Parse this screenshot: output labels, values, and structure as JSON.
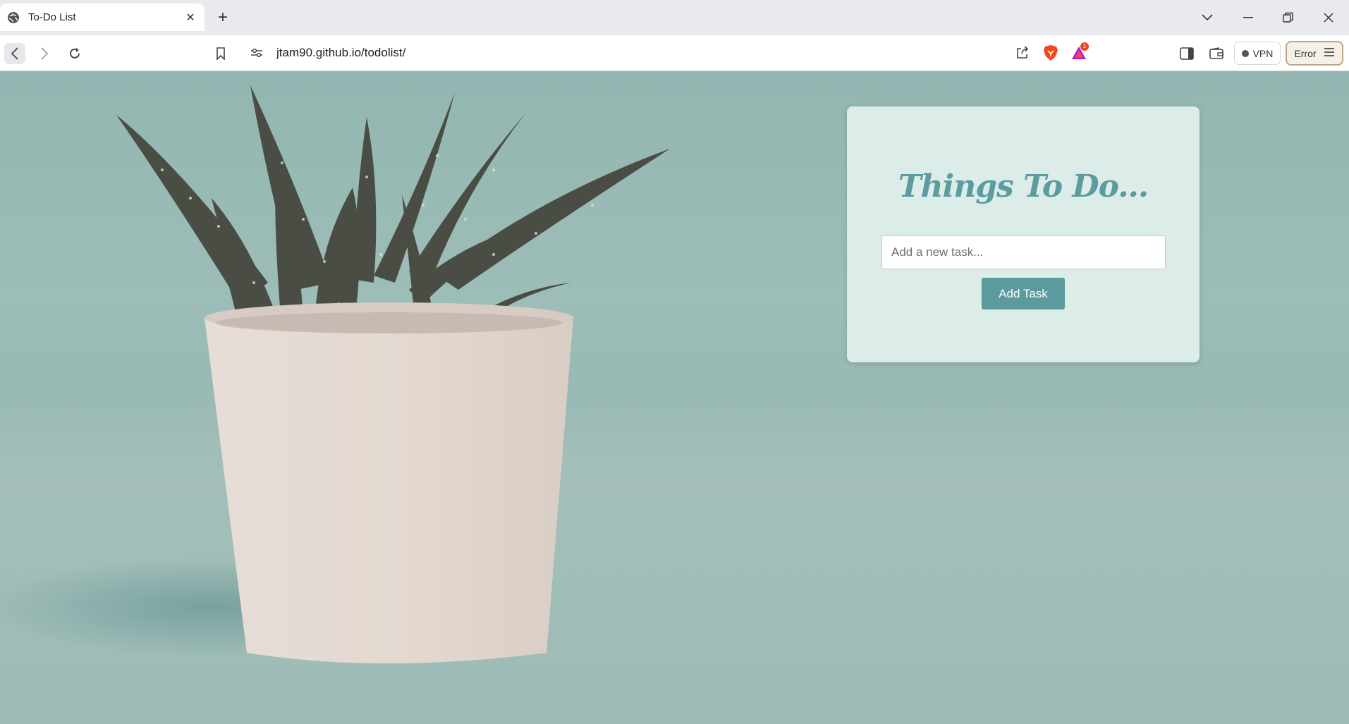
{
  "browser": {
    "tab": {
      "title": "To-Do List"
    },
    "url": "jtam90.github.io/todolist/",
    "vpn_label": "VPN",
    "error_label": "Error",
    "rewards_badge": "1"
  },
  "todo": {
    "title": "Things To Do...",
    "input_placeholder": "Add a new task...",
    "add_button_label": "Add Task"
  },
  "colors": {
    "accent": "#5b9a9d",
    "card_background": "#dcece8",
    "page_background": "#9fbcb8"
  }
}
